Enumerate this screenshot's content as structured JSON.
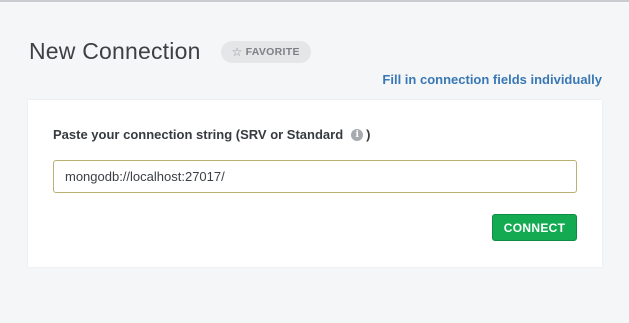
{
  "header": {
    "title": "New Connection",
    "favorite_label": "FAVORITE",
    "favorite_icon": "star-outline-icon"
  },
  "links": {
    "fill_individually": "Fill in connection fields individually"
  },
  "form": {
    "label": "Paste your connection string (SRV or Standard",
    "label_close": ")",
    "info_icon": "info-icon",
    "connection_string_value": "mongodb://localhost:27017/",
    "connect_label": "CONNECT"
  },
  "colors": {
    "accent_green": "#13aa52",
    "link_blue": "#3978b5"
  }
}
